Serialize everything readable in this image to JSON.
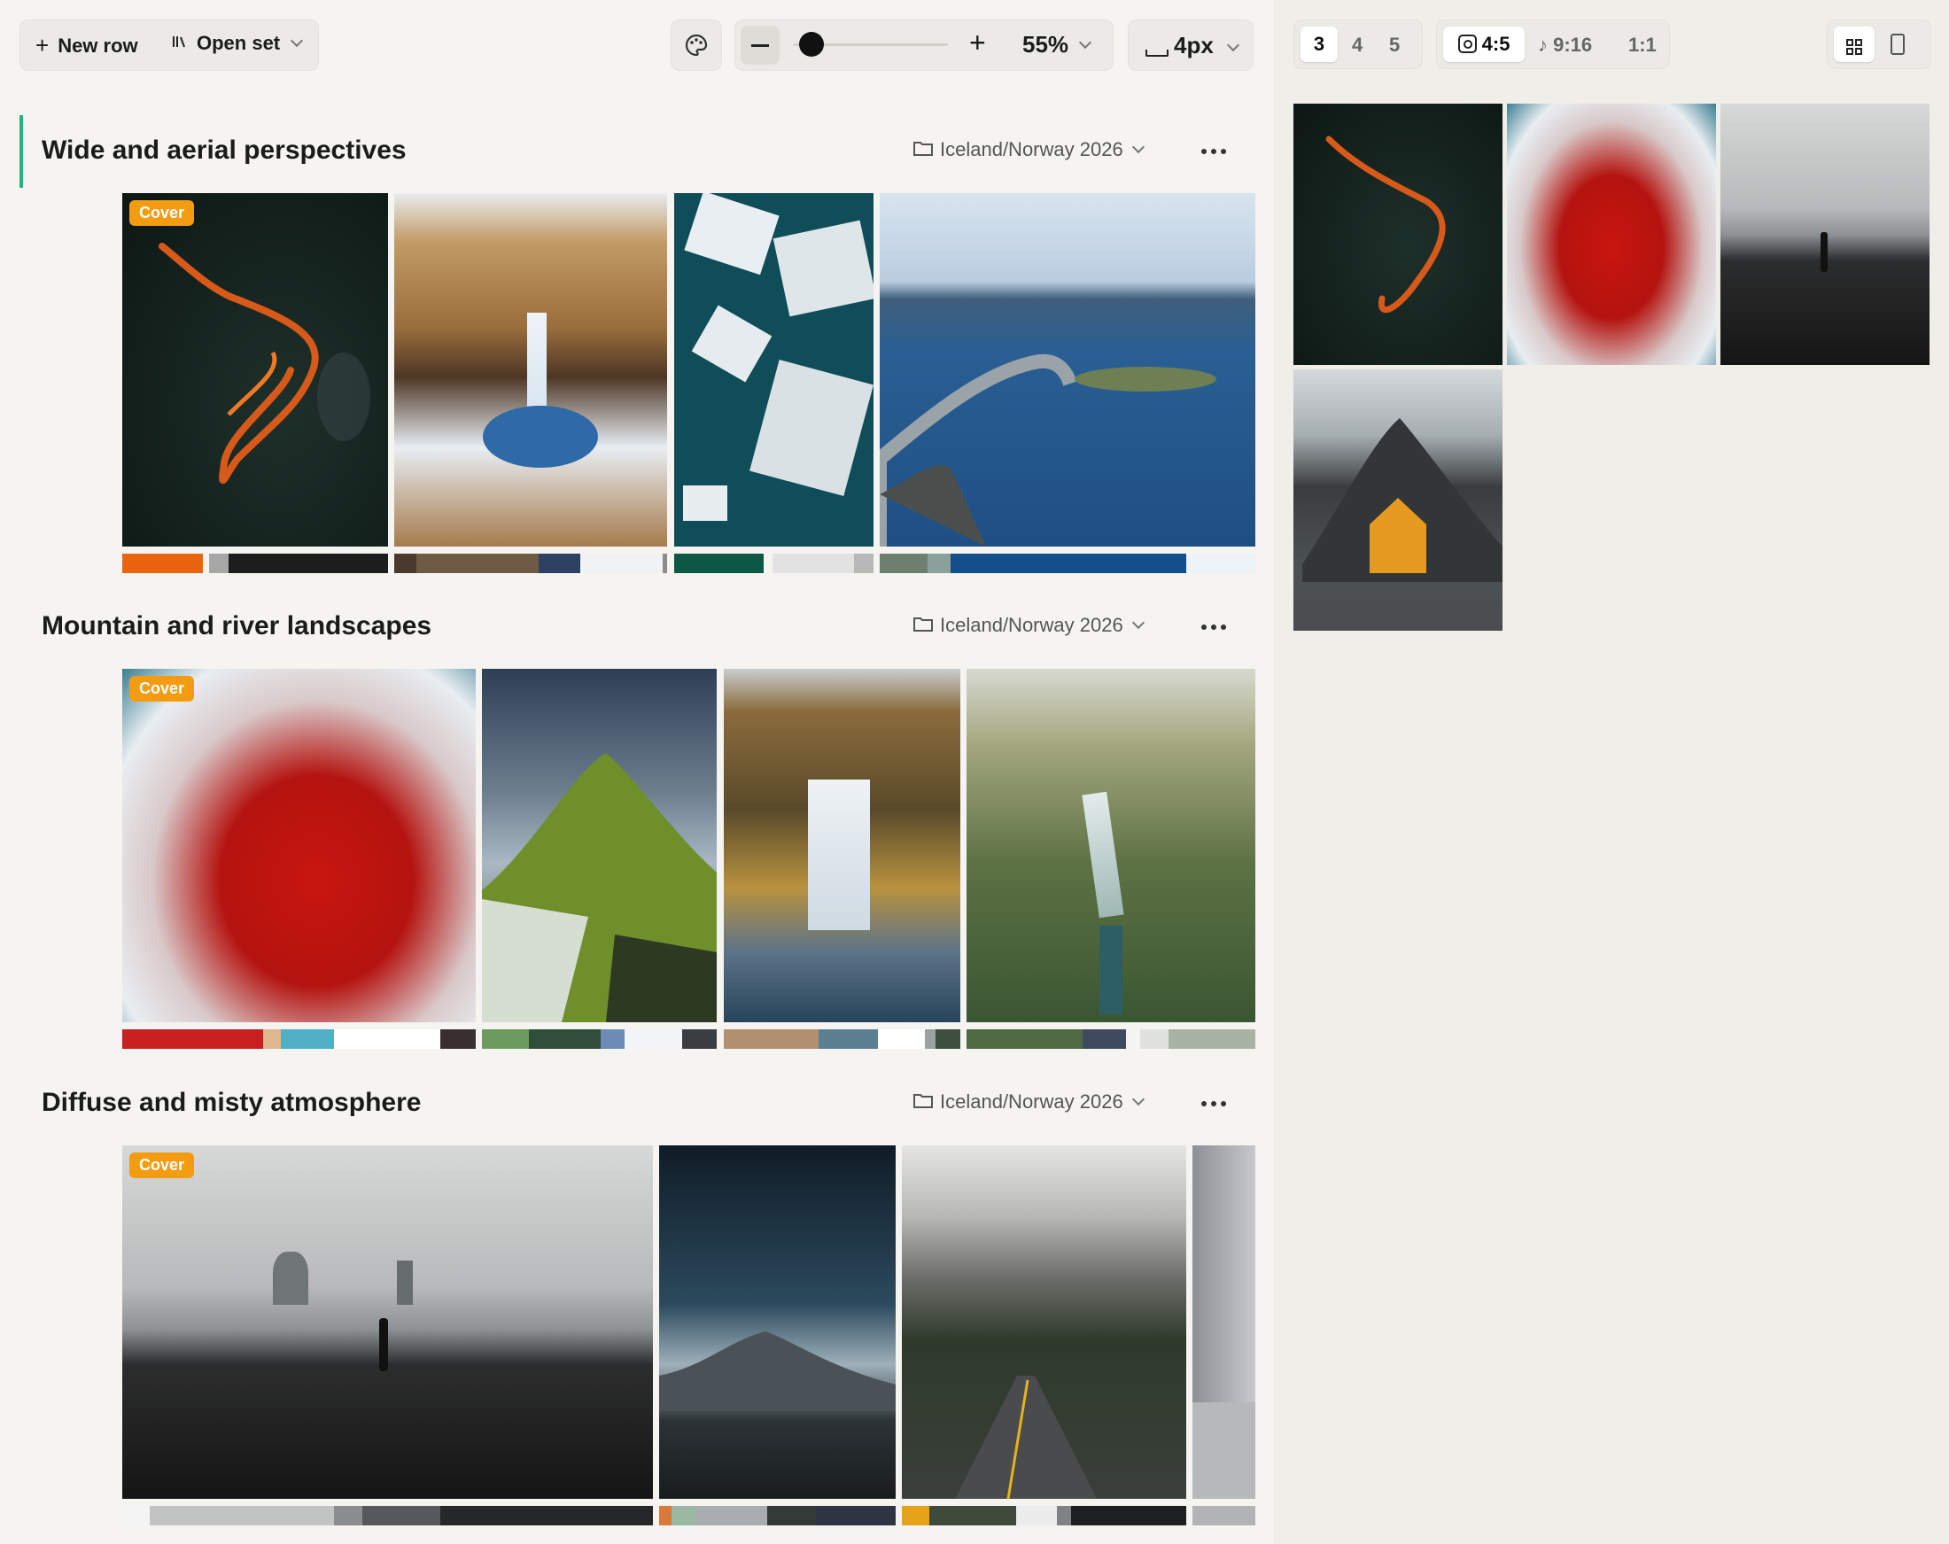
{
  "toolbar": {
    "new_row_label": "New row",
    "open_set_label": "Open set",
    "zoom_percent_label": "55%",
    "zoom_level": 0.1,
    "gap_label": "4px"
  },
  "rows": [
    {
      "title": "Wide and aerial perspectives",
      "folder": "Iceland/Norway 2026",
      "cover_label": "Cover"
    },
    {
      "title": "Mountain and river landscapes",
      "folder": "Iceland/Norway 2026",
      "cover_label": "Cover"
    },
    {
      "title": "Diffuse and misty atmosphere",
      "folder": "Iceland/Norway 2026",
      "cover_label": "Cover"
    }
  ],
  "right_panel": {
    "columns": [
      "3",
      "4",
      "5"
    ],
    "active_column": "3",
    "ratios": [
      {
        "label": "4:5",
        "icon": "instagram-icon"
      },
      {
        "label": "9:16",
        "icon": "tiktok-icon"
      },
      {
        "label": "1:1",
        "icon": ""
      }
    ],
    "active_ratio": "4:5",
    "view_modes": [
      "grid-icon",
      "phone-icon"
    ]
  },
  "colors": {
    "accent": "#1fb57a",
    "cover_badge": "#f39c12",
    "panel_bg": "#efeee9"
  }
}
